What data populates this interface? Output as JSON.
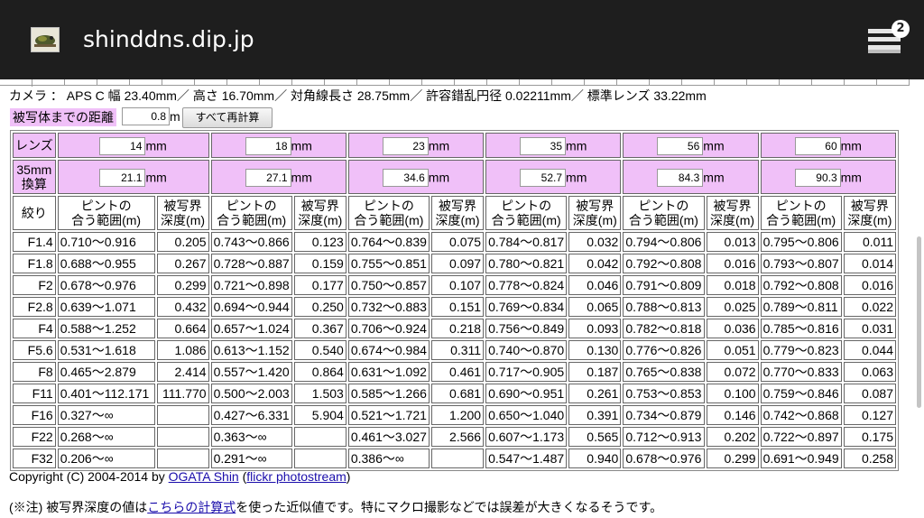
{
  "browser": {
    "site_title": "shinddns.dip.jp",
    "tab_count": "2",
    "favicon": "frog-photo-icon",
    "tabs_icon": "tabs-icon"
  },
  "camera_info": "カメラ ： APS C 幅 23.40mm／ 高さ 16.70mm／ 対角線長さ 28.75mm／ 許容錯乱円径 0.02211mm／ 標準レンズ 33.22mm",
  "distance": {
    "label": "被写体までの距離",
    "value": "0.8",
    "unit": "m",
    "recalc_button": "すべて再計算"
  },
  "table": {
    "lens_label": "レンズ",
    "equiv_label_1": "35mm",
    "equiv_label_2": "換算",
    "unit": "mm",
    "aperture_label": "絞り",
    "focus_head_1": "ピントの",
    "focus_head_2": "合う範囲(m)",
    "dof_head_1": "被写界",
    "dof_head_2": "深度(m)",
    "lenses": [
      {
        "focal": "14",
        "equiv": "21.1"
      },
      {
        "focal": "18",
        "equiv": "27.1"
      },
      {
        "focal": "23",
        "equiv": "34.6"
      },
      {
        "focal": "35",
        "equiv": "52.7"
      },
      {
        "focal": "56",
        "equiv": "84.3"
      },
      {
        "focal": "60",
        "equiv": "90.3"
      }
    ],
    "rows": [
      {
        "f": "F1.4",
        "cells": [
          [
            "0.710～0.916",
            "0.205"
          ],
          [
            "0.743～0.866",
            "0.123"
          ],
          [
            "0.764～0.839",
            "0.075"
          ],
          [
            "0.784～0.817",
            "0.032"
          ],
          [
            "0.794～0.806",
            "0.013"
          ],
          [
            "0.795～0.806",
            "0.011"
          ]
        ]
      },
      {
        "f": "F1.8",
        "cells": [
          [
            "0.688～0.955",
            "0.267"
          ],
          [
            "0.728～0.887",
            "0.159"
          ],
          [
            "0.755～0.851",
            "0.097"
          ],
          [
            "0.780～0.821",
            "0.042"
          ],
          [
            "0.792～0.808",
            "0.016"
          ],
          [
            "0.793～0.807",
            "0.014"
          ]
        ]
      },
      {
        "f": "F2",
        "cells": [
          [
            "0.678～0.976",
            "0.299"
          ],
          [
            "0.721～0.898",
            "0.177"
          ],
          [
            "0.750～0.857",
            "0.107"
          ],
          [
            "0.778～0.824",
            "0.046"
          ],
          [
            "0.791～0.809",
            "0.018"
          ],
          [
            "0.792～0.808",
            "0.016"
          ]
        ]
      },
      {
        "f": "F2.8",
        "cells": [
          [
            "0.639～1.071",
            "0.432"
          ],
          [
            "0.694～0.944",
            "0.250"
          ],
          [
            "0.732～0.883",
            "0.151"
          ],
          [
            "0.769～0.834",
            "0.065"
          ],
          [
            "0.788～0.813",
            "0.025"
          ],
          [
            "0.789～0.811",
            "0.022"
          ]
        ]
      },
      {
        "f": "F4",
        "cells": [
          [
            "0.588～1.252",
            "0.664"
          ],
          [
            "0.657～1.024",
            "0.367"
          ],
          [
            "0.706～0.924",
            "0.218"
          ],
          [
            "0.756～0.849",
            "0.093"
          ],
          [
            "0.782～0.818",
            "0.036"
          ],
          [
            "0.785～0.816",
            "0.031"
          ]
        ]
      },
      {
        "f": "F5.6",
        "cells": [
          [
            "0.531～1.618",
            "1.086"
          ],
          [
            "0.613～1.152",
            "0.540"
          ],
          [
            "0.674～0.984",
            "0.311"
          ],
          [
            "0.740～0.870",
            "0.130"
          ],
          [
            "0.776～0.826",
            "0.051"
          ],
          [
            "0.779～0.823",
            "0.044"
          ]
        ]
      },
      {
        "f": "F8",
        "cells": [
          [
            "0.465～2.879",
            "2.414"
          ],
          [
            "0.557～1.420",
            "0.864"
          ],
          [
            "0.631～1.092",
            "0.461"
          ],
          [
            "0.717～0.905",
            "0.187"
          ],
          [
            "0.765～0.838",
            "0.072"
          ],
          [
            "0.770～0.833",
            "0.063"
          ]
        ]
      },
      {
        "f": "F11",
        "cells": [
          [
            "0.401～112.171",
            "111.770"
          ],
          [
            "0.500～2.003",
            "1.503"
          ],
          [
            "0.585～1.266",
            "0.681"
          ],
          [
            "0.690～0.951",
            "0.261"
          ],
          [
            "0.753～0.853",
            "0.100"
          ],
          [
            "0.759～0.846",
            "0.087"
          ]
        ]
      },
      {
        "f": "F16",
        "cells": [
          [
            "0.327～∞",
            ""
          ],
          [
            "0.427～6.331",
            "5.904"
          ],
          [
            "0.521～1.721",
            "1.200"
          ],
          [
            "0.650～1.040",
            "0.391"
          ],
          [
            "0.734～0.879",
            "0.146"
          ],
          [
            "0.742～0.868",
            "0.127"
          ]
        ]
      },
      {
        "f": "F22",
        "cells": [
          [
            "0.268～∞",
            ""
          ],
          [
            "0.363～∞",
            ""
          ],
          [
            "0.461～3.027",
            "2.566"
          ],
          [
            "0.607～1.173",
            "0.565"
          ],
          [
            "0.712～0.913",
            "0.202"
          ],
          [
            "0.722～0.897",
            "0.175"
          ]
        ]
      },
      {
        "f": "F32",
        "cells": [
          [
            "0.206～∞",
            ""
          ],
          [
            "0.291～∞",
            ""
          ],
          [
            "0.386～∞",
            ""
          ],
          [
            "0.547～1.487",
            "0.940"
          ],
          [
            "0.678～0.976",
            "0.299"
          ],
          [
            "0.691～0.949",
            "0.258"
          ]
        ]
      }
    ]
  },
  "footer": {
    "copyright_prefix": "Copyright (C) 2004-2014 by ",
    "author_link": "OGATA Shin",
    "paren_open": " (",
    "flickr_link": "flickr photostream",
    "paren_close": ")",
    "note_prefix": "(※注) 被写界深度の値は",
    "formula_link": "こちらの計算式",
    "note_suffix": "を使った近似値です。特にマクロ撮影などでは誤差が大きくなるそうです。"
  }
}
